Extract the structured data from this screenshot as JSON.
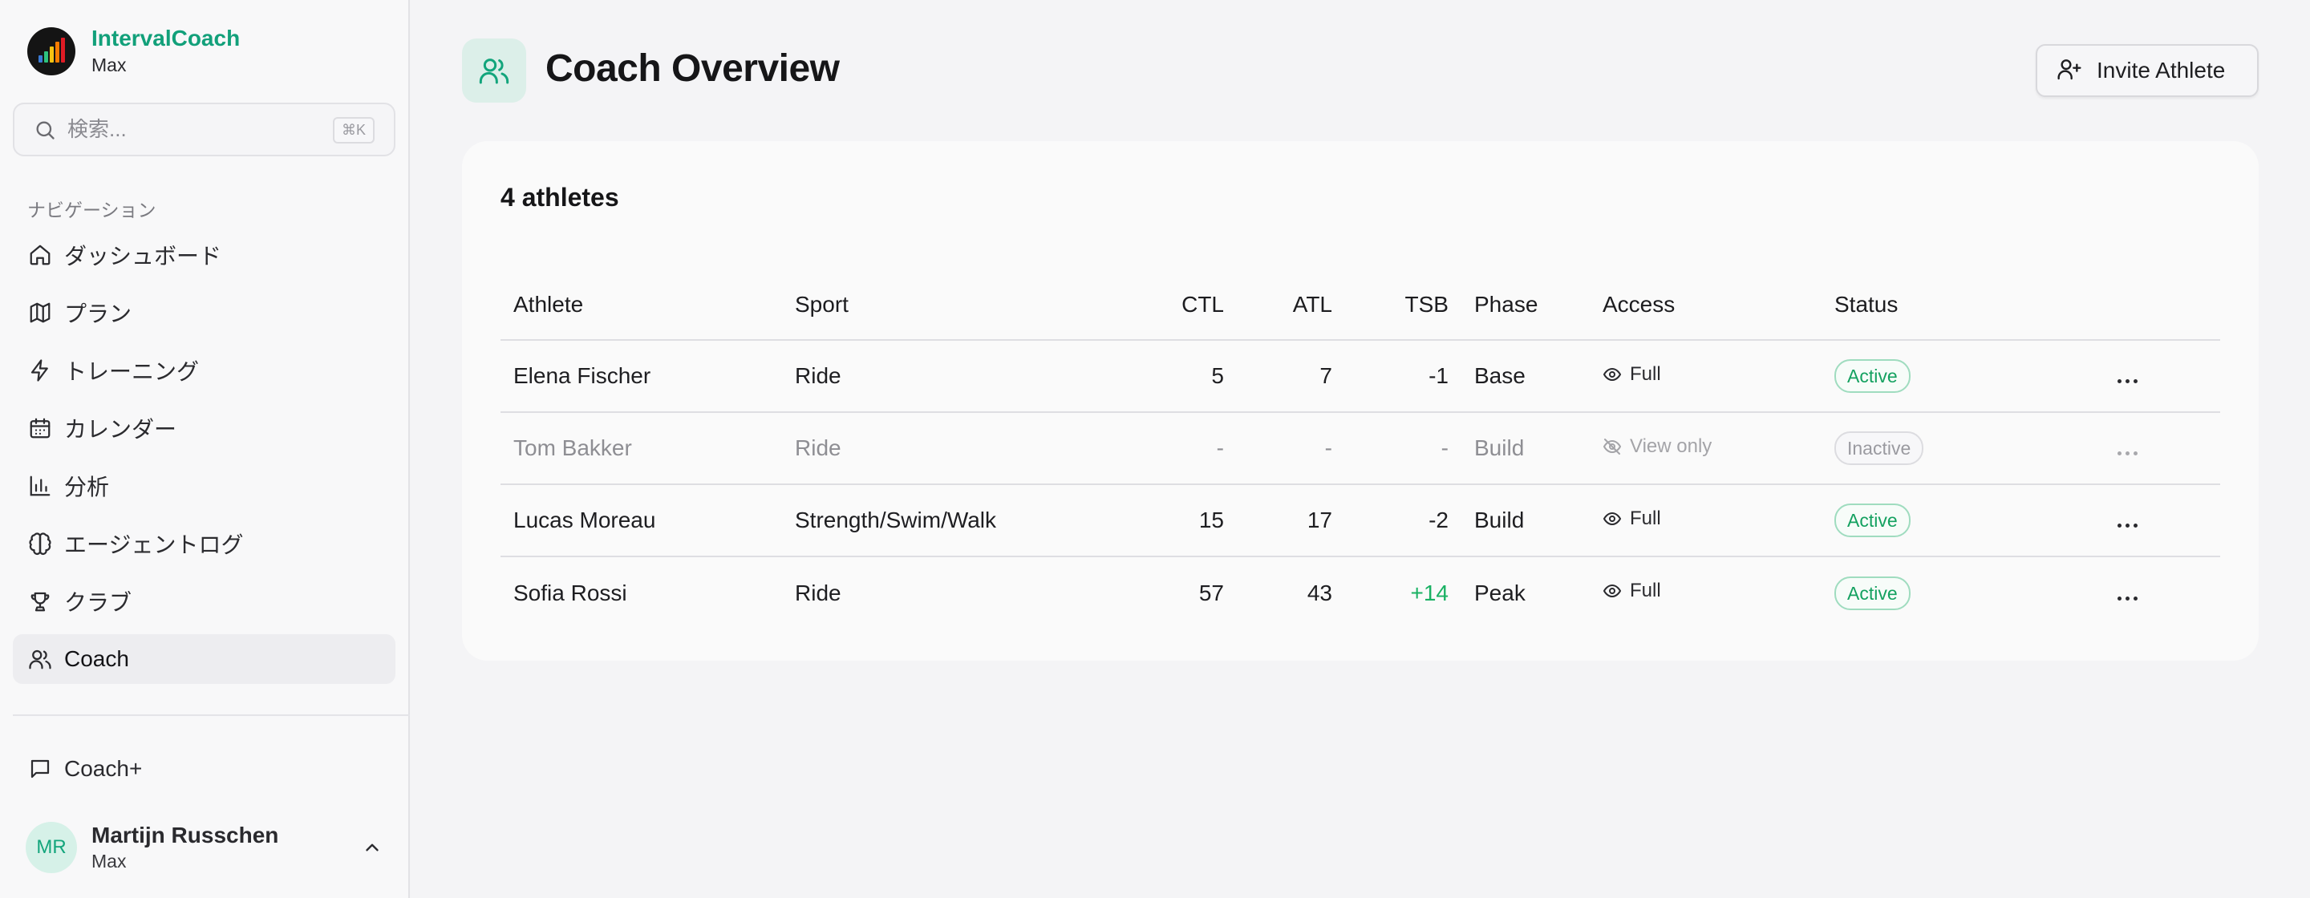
{
  "app": {
    "name": "IntervalCoach",
    "subtitle": "Max"
  },
  "search": {
    "placeholder": "検索...",
    "shortcut": "⌘K"
  },
  "nav": {
    "heading": "ナビゲーション",
    "items": [
      {
        "label": "ダッシュボード",
        "icon": "home-icon"
      },
      {
        "label": "プラン",
        "icon": "map-icon"
      },
      {
        "label": "トレーニング",
        "icon": "lightning-icon"
      },
      {
        "label": "カレンダー",
        "icon": "calendar-icon"
      },
      {
        "label": "分析",
        "icon": "bar-chart-icon"
      },
      {
        "label": "エージェントログ",
        "icon": "brain-icon"
      },
      {
        "label": "クラブ",
        "icon": "trophy-icon"
      },
      {
        "label": "Coach",
        "icon": "users-icon",
        "active": true
      }
    ]
  },
  "coachplus": {
    "label": "Coach+",
    "icon": "message-icon"
  },
  "user": {
    "initials": "MR",
    "name": "Martijn Russchen",
    "subtitle": "Max"
  },
  "page": {
    "title": "Coach Overview",
    "invite_label": "Invite Athlete"
  },
  "card": {
    "title": "4 athletes"
  },
  "table": {
    "headers": {
      "athlete": "Athlete",
      "sport": "Sport",
      "ctl": "CTL",
      "atl": "ATL",
      "tsb": "TSB",
      "phase": "Phase",
      "access": "Access",
      "status": "Status"
    },
    "rows": [
      {
        "athlete": "Elena Fischer",
        "sport": "Ride",
        "ctl": "5",
        "atl": "7",
        "tsb": "-1",
        "phase": "Base",
        "access": "Full",
        "status": "Active"
      },
      {
        "athlete": "Tom Bakker",
        "sport": "Ride",
        "ctl": "-",
        "atl": "-",
        "tsb": "-",
        "phase": "Build",
        "access": "View only",
        "status": "Inactive"
      },
      {
        "athlete": "Lucas Moreau",
        "sport": "Strength/Swim/Walk",
        "ctl": "15",
        "atl": "17",
        "tsb": "-2",
        "phase": "Build",
        "access": "Full",
        "status": "Active"
      },
      {
        "athlete": "Sofia Rossi",
        "sport": "Ride",
        "ctl": "57",
        "atl": "43",
        "tsb": "+14",
        "phase": "Peak",
        "access": "Full",
        "status": "Active"
      }
    ]
  },
  "colors": {
    "brand": "#12a07a",
    "active": "#14a160",
    "positive": "#19b163"
  }
}
